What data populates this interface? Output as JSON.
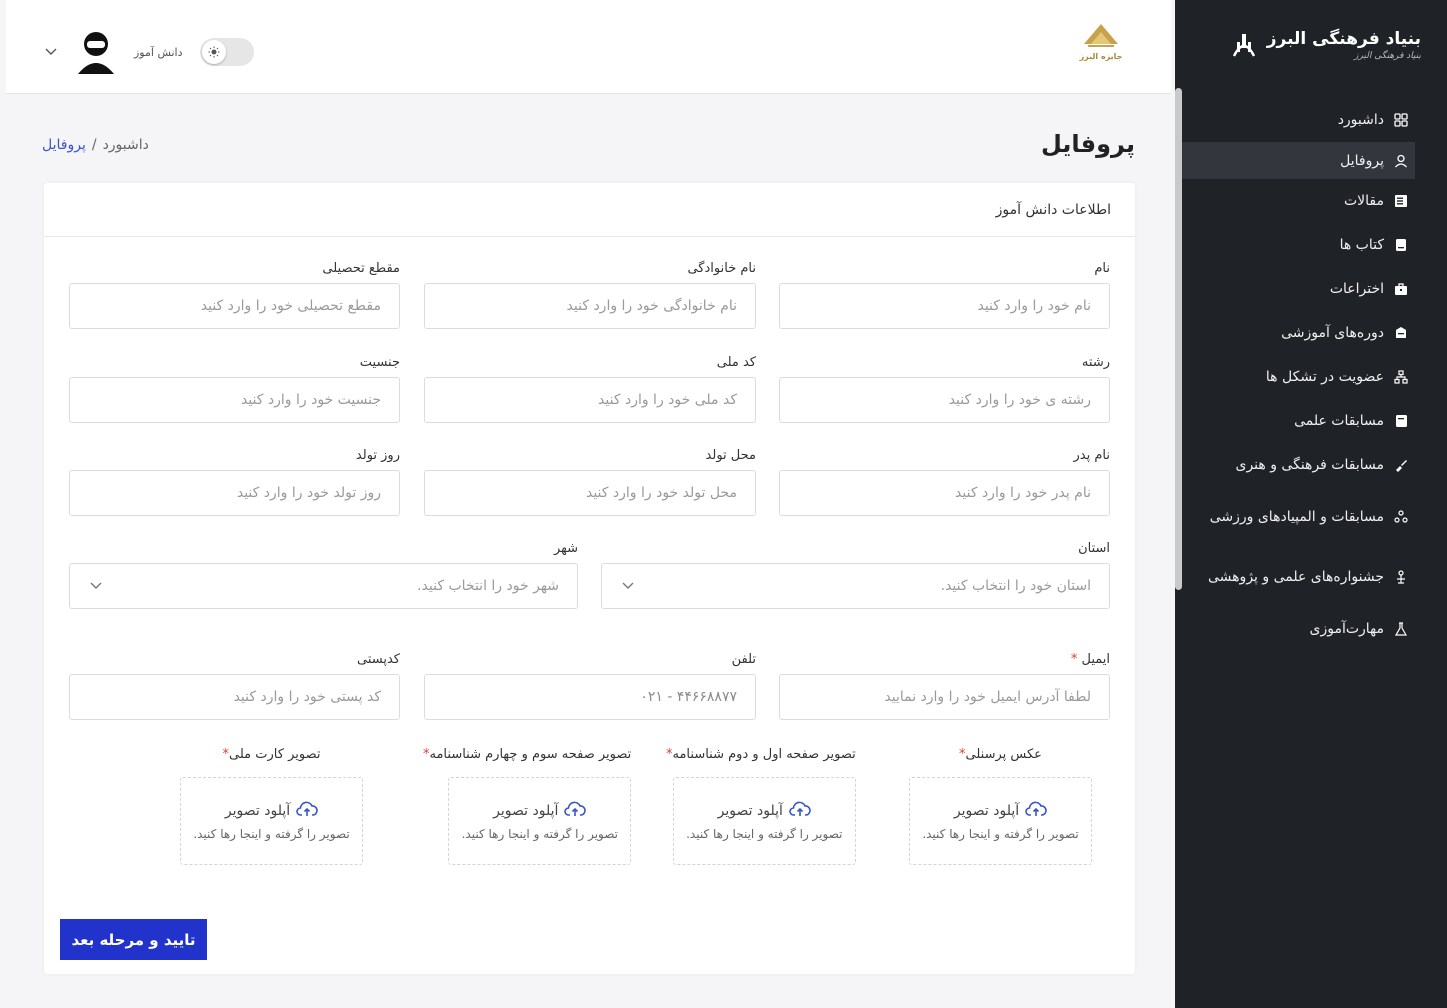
{
  "brand": {
    "title": "بنیاد فرهنگی البرز",
    "subtitle": "بنیاد فرهنگی البرز"
  },
  "header": {
    "role_label": "دانش آموز",
    "logo_text": "جایزه البرز"
  },
  "sidebar": {
    "items": [
      {
        "label": "داشبورد",
        "icon": "grid-icon"
      },
      {
        "label": "پروفایل",
        "icon": "user-icon",
        "active": true
      },
      {
        "label": "مقالات",
        "icon": "article-icon"
      },
      {
        "label": "کتاب ها",
        "icon": "book-icon"
      },
      {
        "label": "اختراعات",
        "icon": "briefcase-icon"
      },
      {
        "label": "دوره‌های آموزشی",
        "icon": "course-icon"
      },
      {
        "label": "عضویت در تشکل ها",
        "icon": "org-chart-icon"
      },
      {
        "label": "مسابقات علمی",
        "icon": "notebook-icon"
      },
      {
        "label": "مسابقات فرهنگی و هنری",
        "icon": "paint-icon"
      },
      {
        "label": "مسابقات و المپیادهای ورزشی",
        "icon": "sport-icon"
      },
      {
        "label": "جشنواره‌های علمی و پژوهشی",
        "icon": "research-icon"
      },
      {
        "label": "مهارت‌آموزی",
        "icon": "flask-icon"
      }
    ]
  },
  "page": {
    "title": "پروفایل"
  },
  "breadcrumb": {
    "home": "داشبورد",
    "separator": "/",
    "current": "پروفایل"
  },
  "card": {
    "title": "اطلاعات دانش آموز"
  },
  "fields": {
    "first_name": {
      "label": "نام",
      "placeholder": "نام خود را وارد کنید"
    },
    "last_name": {
      "label": "نام خانوادگی",
      "placeholder": "نام خانوادگی خود را وارد کنید"
    },
    "grade": {
      "label": "مقطع تحصیلی",
      "placeholder": "مقطع تحصیلی خود را وارد کنید"
    },
    "major": {
      "label": "رشته",
      "placeholder": "رشته ی خود را وارد کنید"
    },
    "national_code": {
      "label": "کد ملی",
      "placeholder": "کد ملی خود را وارد کنید"
    },
    "gender": {
      "label": "جنسیت",
      "placeholder": "جنسیت خود را وارد کنید"
    },
    "father_name": {
      "label": "نام پدر",
      "placeholder": "نام پدر خود را وارد کنید"
    },
    "birthplace": {
      "label": "محل تولد",
      "placeholder": "محل تولد خود را وارد کنید"
    },
    "birthday": {
      "label": "روز تولد",
      "placeholder": "روز تولد خود را وارد کنید"
    },
    "province": {
      "label": "استان",
      "placeholder": "استان خود را انتخاب کنید."
    },
    "city": {
      "label": "شهر",
      "placeholder": "شهر خود را انتخاب کنید."
    },
    "email": {
      "label": "ایمیل",
      "required": "*",
      "placeholder": "لطفا آدرس ایمیل خود را وارد نمایید"
    },
    "phone": {
      "label": "تلفن",
      "value": "۰۲۱ - ۴۴۶۶۸۸۷۷"
    },
    "postal_code": {
      "label": "کدپستی",
      "placeholder": "کد پستی خود را وارد کنید"
    }
  },
  "uploads": {
    "button_text": "آپلود تصویر",
    "hint": "تصویر را گرفته و اینجا رها کنید.",
    "items": [
      {
        "label": "عکس پرسنلی",
        "required": "*"
      },
      {
        "label": "تصویر صفحه اول و دوم شناسنامه",
        "required": "*"
      },
      {
        "label": "تصویر صفحه سوم و چهارم شناسنامه",
        "required": "*"
      },
      {
        "label": "تصویر کارت ملی",
        "required": "*"
      }
    ]
  },
  "submit": {
    "label": "تایید و مرحله بعد"
  },
  "colors": {
    "sidebar_bg": "#1f2226",
    "primary": "#2233cc",
    "required": "#e53935",
    "link": "#3a55c9"
  }
}
